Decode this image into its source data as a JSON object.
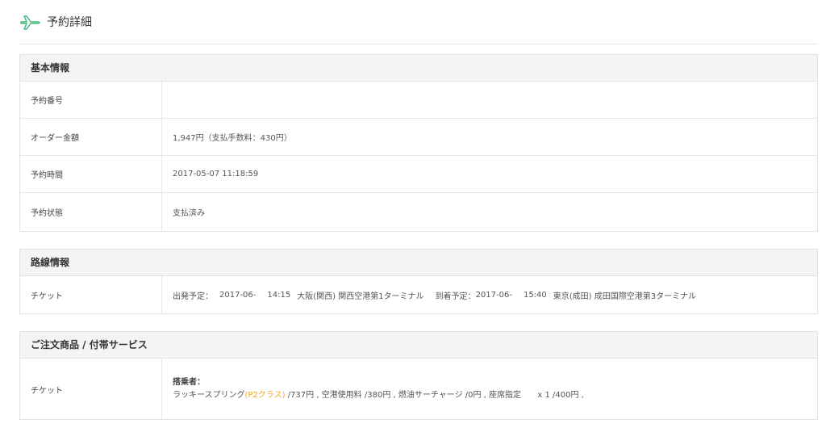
{
  "header": {
    "title": "予約詳細",
    "icon": "airplane-icon",
    "icon_color": "#3cb878"
  },
  "basic_info": {
    "title": "基本情報",
    "rows": [
      {
        "label": "予約番号",
        "value": ""
      },
      {
        "label": "オーダー金額",
        "value": "1,947円（支払手数料：430円）"
      },
      {
        "label": "予約時間",
        "value": "2017-05-07 11:18:59"
      },
      {
        "label": "予約状態",
        "value": "支払済み"
      }
    ]
  },
  "route_info": {
    "title": "路線情報",
    "ticket_label": "チケット",
    "departure_prefix": "出発予定：",
    "departure_date": "2017-06-",
    "departure_time": "14:15",
    "departure_place": "大阪(関西) 関西空港第1ターミナル",
    "arrival_prefix": "到着予定：",
    "arrival_date": "2017-06-",
    "arrival_time": "15:40",
    "arrival_place": "東京(成田) 成田国際空港第3ターミナル"
  },
  "services": {
    "title": "ご注文商品 / 付帯サービス",
    "ticket_label": "チケット",
    "passenger_label": "搭乗者：",
    "airline": "ラッキースプリング",
    "fare_class": "(P2クラス)",
    "details_1": "/737円 , 空港使用料 /380円 , 燃油サーチャージ /0円 , 座席指定",
    "details_2": "x 1 /400円 ,",
    "accent_color": "#f5a623"
  }
}
